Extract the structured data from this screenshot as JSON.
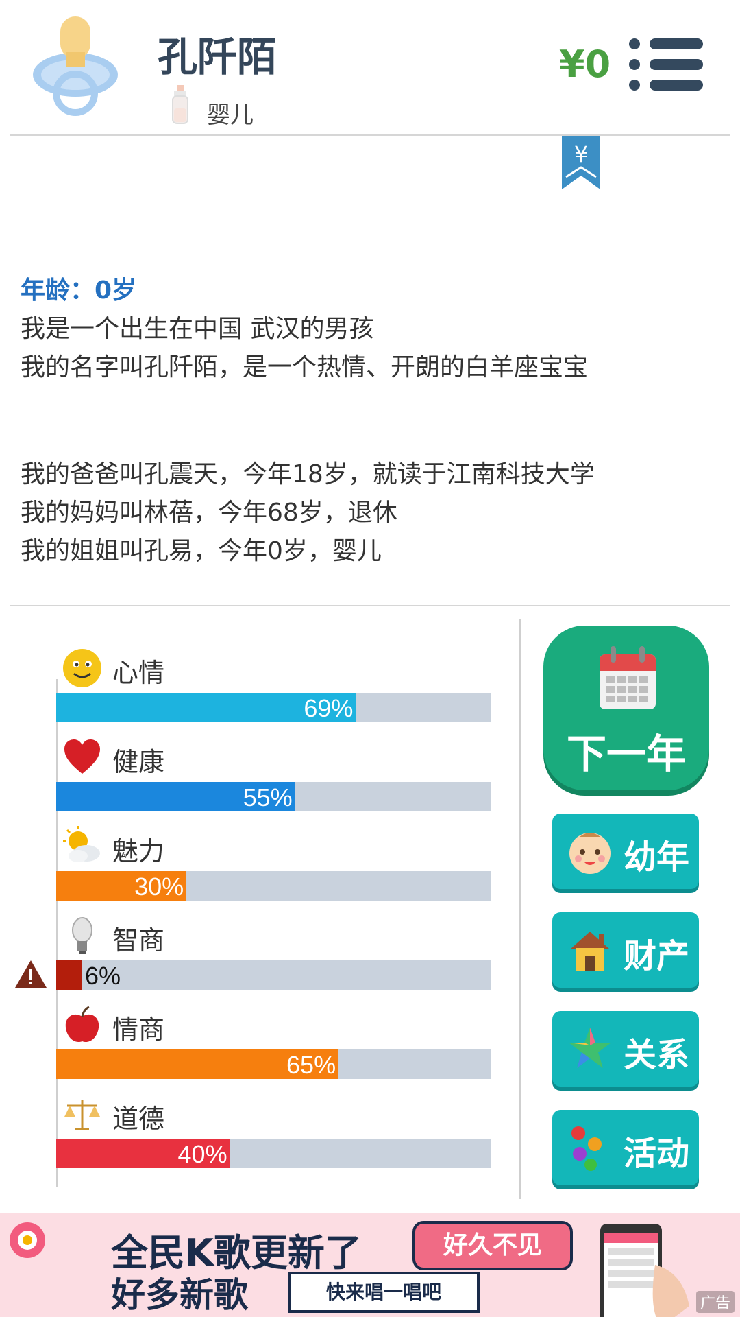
{
  "header": {
    "name": "孔阡陌",
    "stage": "婴儿",
    "money": "¥0"
  },
  "bookmark": {
    "symbol": "¥"
  },
  "story": {
    "age": "年龄：0岁",
    "line1": "我是一个出生在中国 武汉的男孩",
    "line2": "我的名字叫孔阡陌，是一个热情、开朗的白羊座宝宝",
    "line3": "我的爸爸叫孔震天，今年18岁，就读于江南科技大学",
    "line4": "我的妈妈叫林蓓，今年68岁，退休",
    "line5": "我的姐姐叫孔易，今年0岁，婴儿"
  },
  "stats": [
    {
      "label": "心情",
      "value": 69,
      "text": "69%",
      "color": "#1db3df",
      "icon": "smiley-icon"
    },
    {
      "label": "健康",
      "value": 55,
      "text": "55%",
      "color": "#1b87dd",
      "icon": "heart-icon"
    },
    {
      "label": "魅力",
      "value": 30,
      "text": "30%",
      "color": "#f67f0e",
      "icon": "sun-cloud-icon"
    },
    {
      "label": "智商",
      "value": 6,
      "text": "6%",
      "color": "#b31e0c",
      "icon": "lightbulb-icon",
      "warning": true
    },
    {
      "label": "情商",
      "value": 65,
      "text": "65%",
      "color": "#f67f0e",
      "icon": "apple-icon"
    },
    {
      "label": "道德",
      "value": 40,
      "text": "40%",
      "color": "#e8313f",
      "icon": "scales-icon"
    }
  ],
  "buttons": {
    "next_year": "下一年",
    "childhood": "幼年",
    "property": "财产",
    "relations": "关系",
    "activities": "活动"
  },
  "ad": {
    "title": "全民K歌更新了",
    "subtitle": "好多新歌",
    "bubble": "好久不见",
    "cta": "快来唱一唱吧",
    "tag": "广告"
  },
  "colors": {
    "money": "#4aa042",
    "age": "#2470c0",
    "next_year_bg": "#1aab7d",
    "side_button_bg": "#13b7b9",
    "track": "#c9d2dd"
  }
}
